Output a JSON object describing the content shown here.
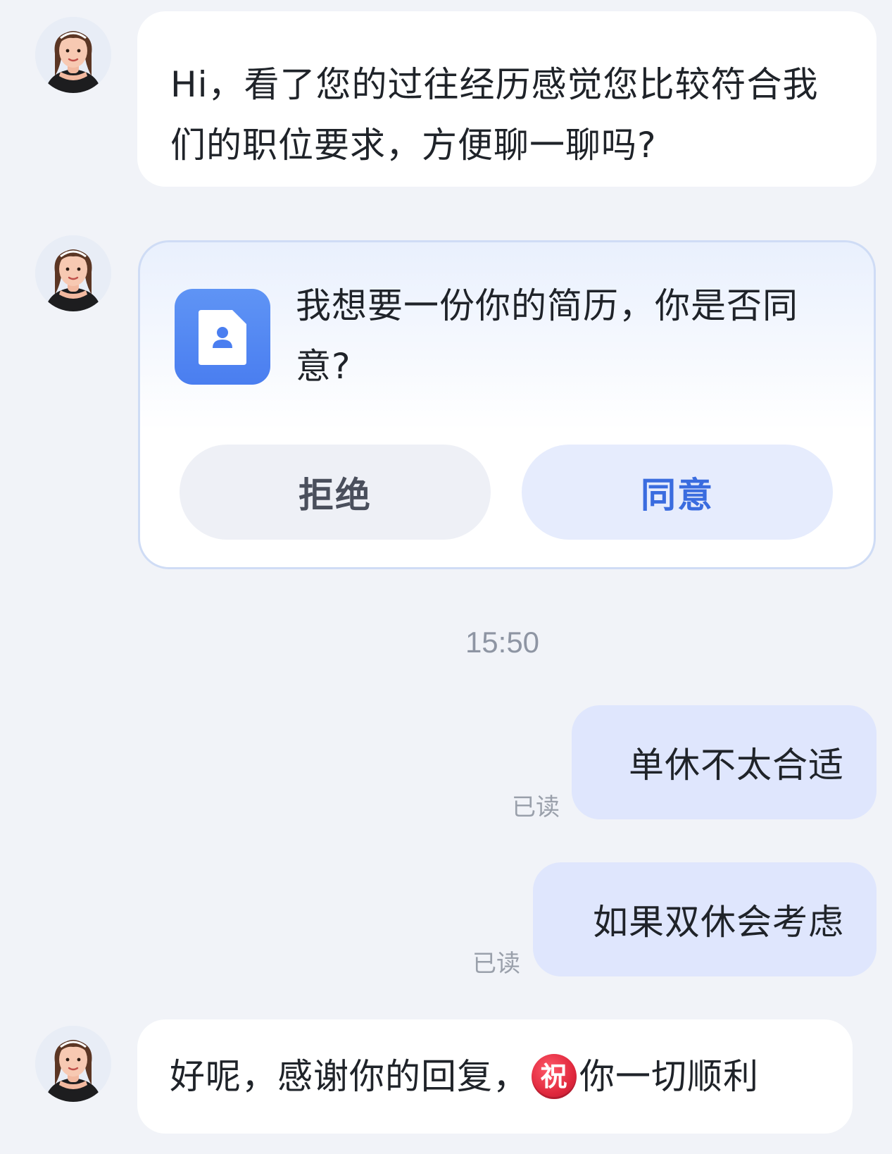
{
  "conversation": {
    "incoming_1": "Hi，看了您的过往经历感觉您比较符合我们的职位要求，方便聊一聊吗?",
    "resume_request": {
      "text": "我想要一份你的简历，你是否同意?",
      "reject_label": "拒绝",
      "accept_label": "同意",
      "icon": "resume-contact-icon"
    },
    "timestamp": "15:50",
    "outgoing_1": {
      "text": "单休不太合适",
      "status": "已读"
    },
    "outgoing_2": {
      "text": "如果双休会考虑",
      "status": "已读"
    },
    "incoming_2": {
      "text_before": "好呢，感谢你的回复，",
      "emoji": "祝",
      "text_after": "你一切顺利"
    }
  },
  "colors": {
    "page_bg": "#f1f3f8",
    "incoming_bubble": "#ffffff",
    "outgoing_bubble": "#dfe6fd",
    "accent_blue": "#3a6cdf",
    "icon_blue": "#4a7ef0",
    "emoji_red": "#e0283d"
  },
  "avatar": {
    "icon": "recruiter-avatar-icon"
  }
}
